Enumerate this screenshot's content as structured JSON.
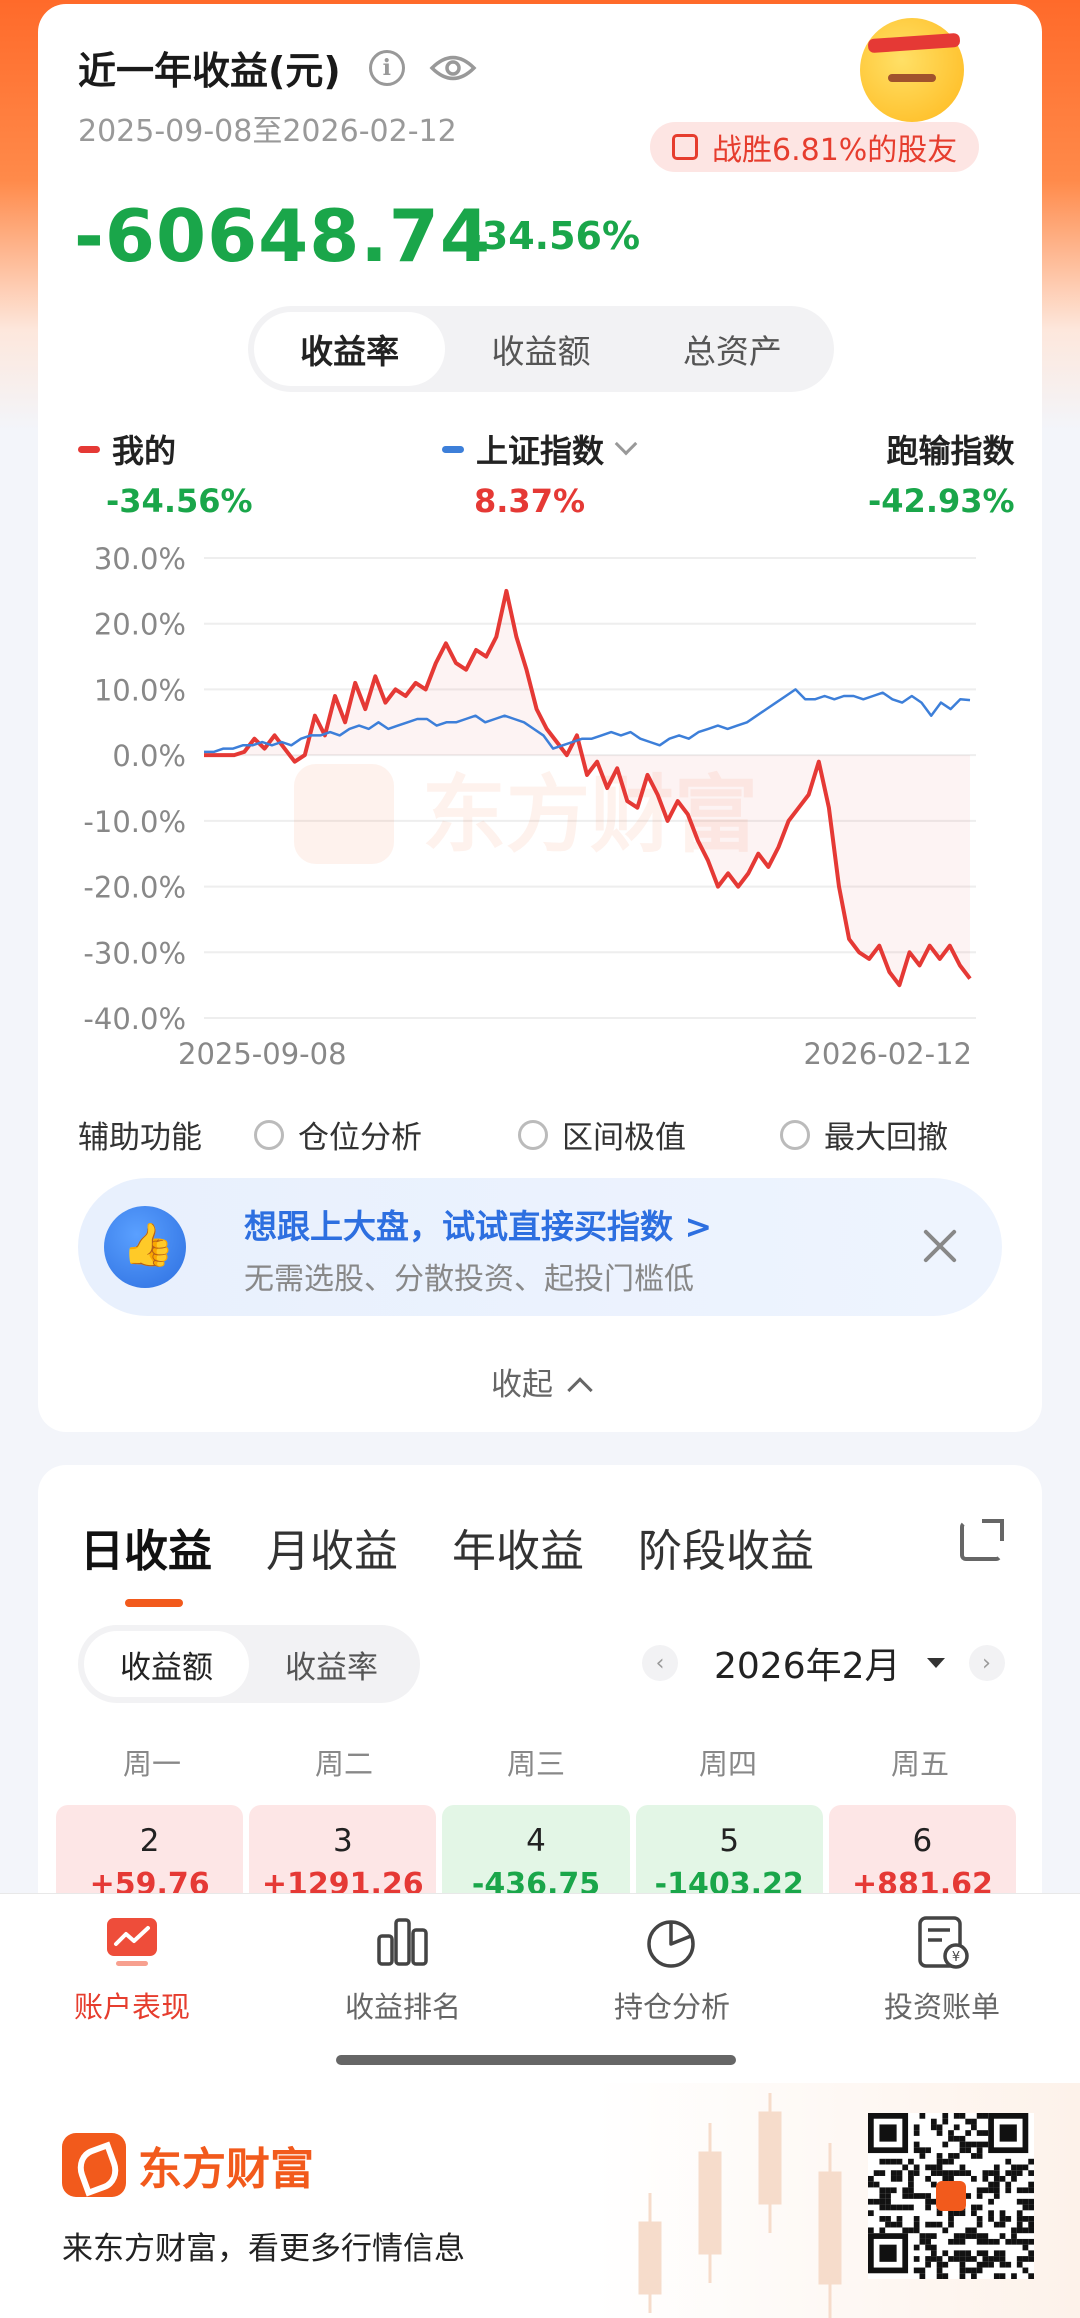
{
  "header": {
    "title": "近一年收益(元)",
    "info_icon": "info-icon",
    "eye_icon": "eye-icon",
    "date_range": "2025-09-08至2026-02-12",
    "beat_badge": "战胜6.81%的股友",
    "amount": "-60648.74",
    "amount_pct": "-34.56%"
  },
  "colors": {
    "accent": "#f25a1c",
    "up_red": "#e53935",
    "down_green": "#1aa64a",
    "index_blue": "#3d7fd9"
  },
  "segment": {
    "options": [
      "收益率",
      "收益额",
      "总资产"
    ],
    "selected": "收益率"
  },
  "legend": {
    "mine_label": "我的",
    "mine_value": "-34.56%",
    "index_label": "上证指数",
    "index_value": "8.37%",
    "lag_label": "跑输指数",
    "lag_value": "-42.93%"
  },
  "chart_data": {
    "type": "line",
    "watermark": "东方财富",
    "x_start_label": "2025-09-08",
    "x_end_label": "2026-02-12",
    "y_ticks": [
      "30.0%",
      "20.0%",
      "10.0%",
      "0.0%",
      "-10.0%",
      "-20.0%",
      "-30.0%",
      "-40.0%"
    ],
    "ylim": [
      -40,
      30
    ],
    "series": [
      {
        "name": "我的",
        "color": "#e53935",
        "values": [
          0,
          0,
          0,
          0,
          0.5,
          2.5,
          1,
          3,
          1,
          -1,
          0,
          6,
          3,
          9,
          5,
          11,
          7,
          12,
          8,
          10,
          9,
          11,
          10,
          14,
          17,
          14,
          13,
          16,
          15,
          18,
          25,
          18,
          13,
          7,
          4,
          2,
          0,
          3,
          -3,
          -1,
          -5,
          -2,
          -7,
          -8,
          -3,
          -6,
          -10,
          -7,
          -9,
          -13,
          -16,
          -20,
          -18,
          -20,
          -18,
          -15,
          -17,
          -14,
          -10,
          -8,
          -6,
          -1,
          -8,
          -20,
          -28,
          -30,
          -31,
          -29,
          -33,
          -35,
          -30,
          -32,
          -29,
          -31,
          -29,
          -32,
          -34
        ]
      },
      {
        "name": "上证指数",
        "color": "#3d7fd9",
        "values": [
          0.5,
          0.5,
          1,
          1,
          1.5,
          1.5,
          2,
          1.5,
          2,
          1.5,
          2.5,
          3,
          3,
          3.5,
          3,
          4,
          4.5,
          4,
          5,
          4,
          4.5,
          5,
          5.5,
          5.5,
          4.5,
          5,
          5,
          5.5,
          6,
          5,
          5.5,
          6,
          5.5,
          5,
          4,
          3,
          1,
          1.5,
          2,
          2.5,
          2.5,
          3,
          3.5,
          3,
          3.5,
          2.5,
          2,
          1.5,
          2.5,
          3,
          2.5,
          3.5,
          4,
          4.5,
          4,
          4.5,
          5,
          6,
          7,
          8,
          9,
          10,
          8.5,
          8.5,
          9,
          8.5,
          9,
          9,
          8.5,
          9,
          9.5,
          8.5,
          8,
          9,
          8,
          6,
          8,
          7,
          8.5,
          8.37
        ]
      }
    ]
  },
  "aux": {
    "label": "辅助功能",
    "options": [
      "仓位分析",
      "区间极值",
      "最大回撤"
    ]
  },
  "promo": {
    "title": "想跟上大盘，试试直接买指数 >",
    "subtitle": "无需选股、分散投资、起投门槛低"
  },
  "collapse_label": "收起",
  "returns": {
    "tabs": [
      "日收益",
      "月收益",
      "年收益",
      "阶段收益"
    ],
    "selected_tab": "日收益",
    "mode_options": [
      "收益额",
      "收益率"
    ],
    "selected_mode": "收益额",
    "month": "2026年2月",
    "weekdays": [
      "周一",
      "周二",
      "周三",
      "周四",
      "周五"
    ],
    "days": [
      {
        "day": "2",
        "value": "+59.76",
        "dir": "up"
      },
      {
        "day": "3",
        "value": "+1291.26",
        "dir": "up"
      },
      {
        "day": "4",
        "value": "-436.75",
        "dir": "down"
      },
      {
        "day": "5",
        "value": "-1403.22",
        "dir": "down"
      },
      {
        "day": "6",
        "value": "+881.62",
        "dir": "up"
      }
    ]
  },
  "bottom_nav": {
    "items": [
      "账户表现",
      "收益排名",
      "持仓分析",
      "投资账单"
    ],
    "active": "账户表现"
  },
  "footer": {
    "brand": "东方财富",
    "slogan": "来东方财富，看更多行情信息"
  }
}
